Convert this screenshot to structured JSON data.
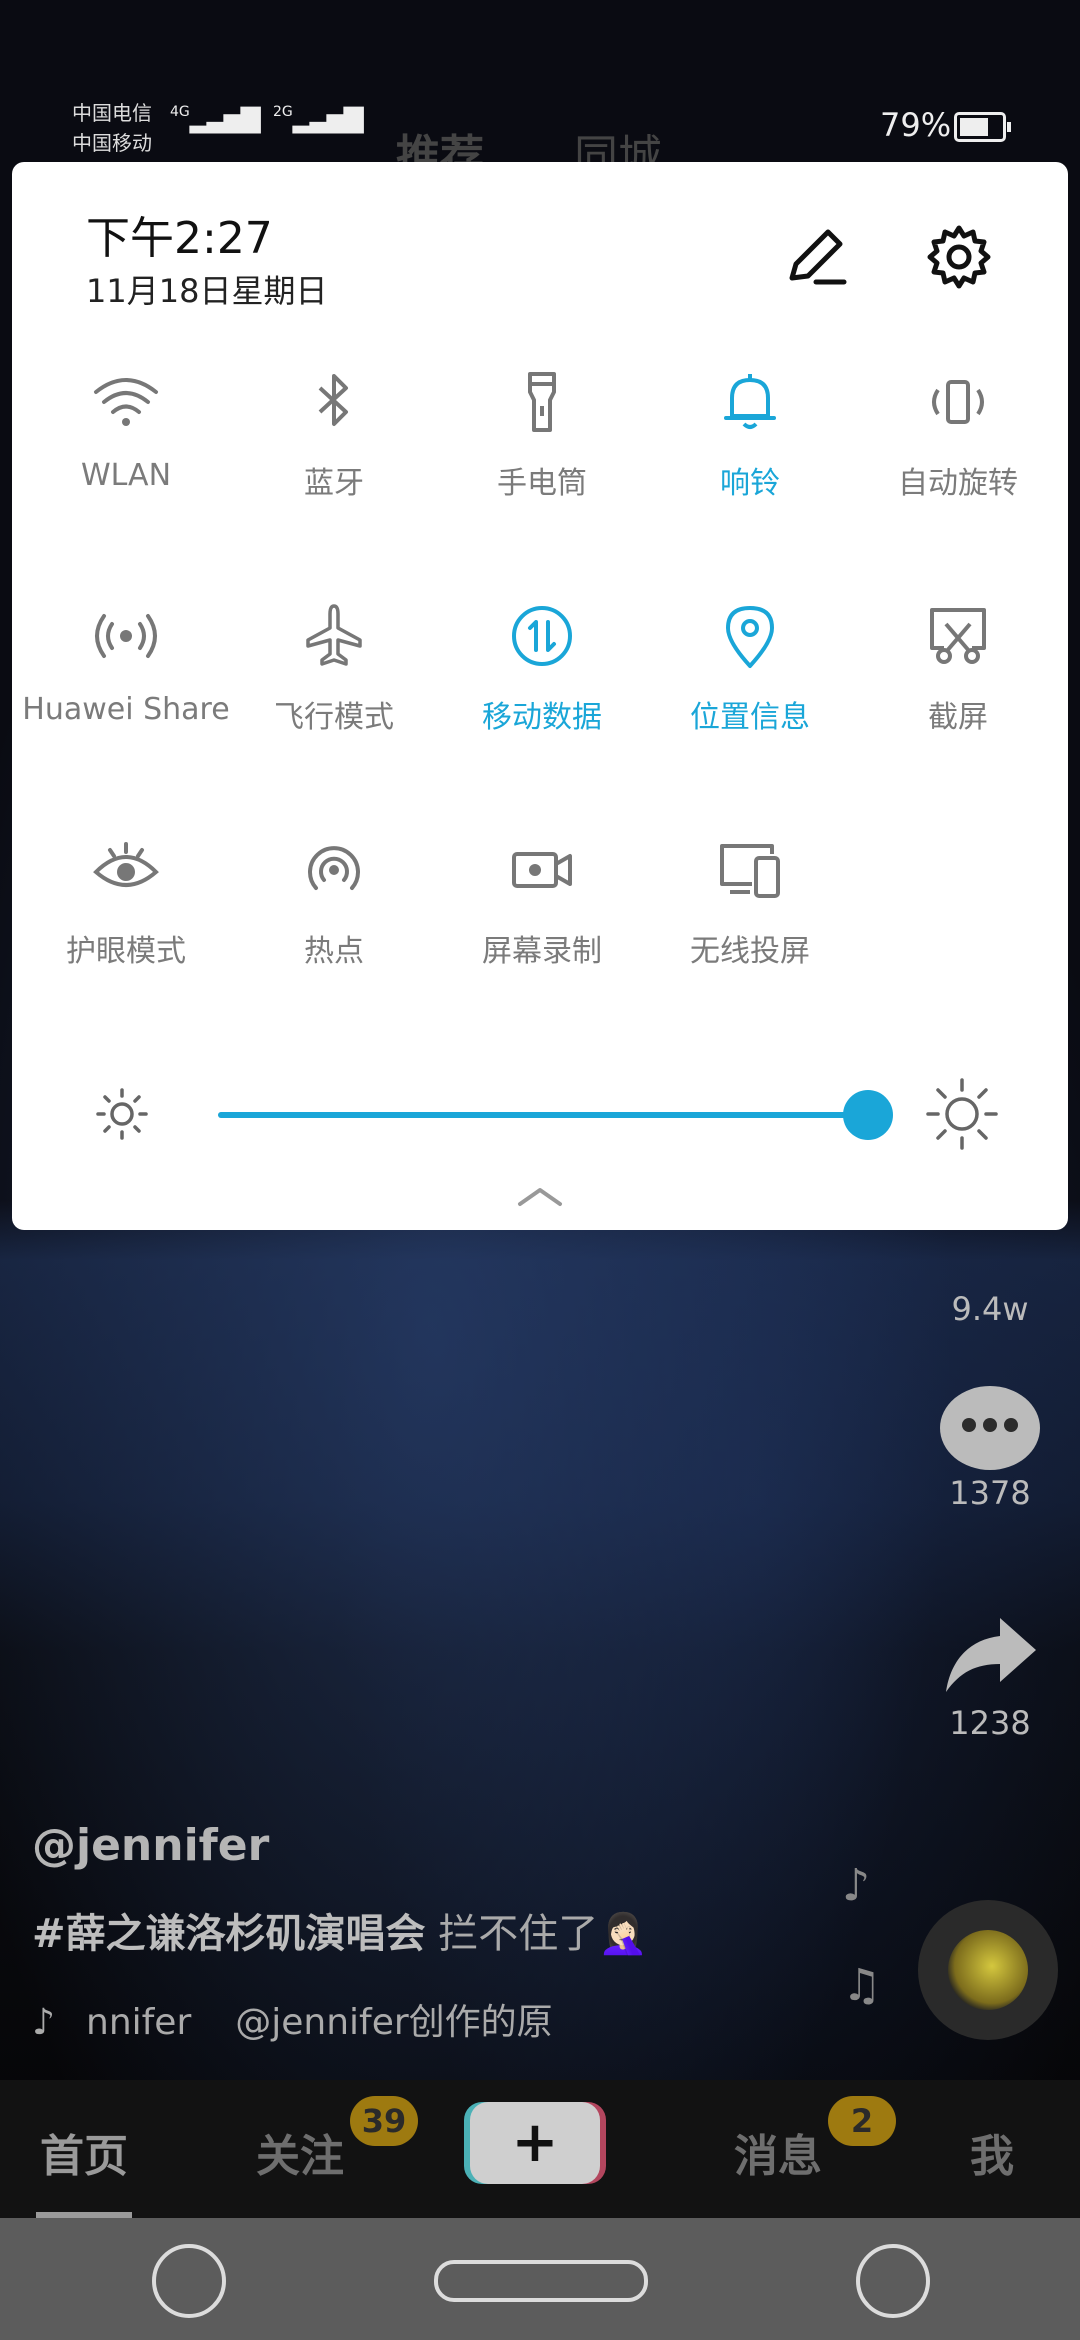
{
  "status_bar": {
    "carrier_1": "中国电信",
    "carrier_2": "中国移动",
    "net_1": "4G",
    "net_2": "2G",
    "battery_percent": "79%"
  },
  "top_tabs": [
    "推荐",
    "同城"
  ],
  "notification_panel": {
    "time": "下午2:27",
    "date": "11月18日星期日",
    "accent_color": "#1aa6d8",
    "tiles": [
      {
        "label": "WLAN",
        "icon": "wifi-icon",
        "active": false
      },
      {
        "label": "蓝牙",
        "icon": "bluetooth-icon",
        "active": false
      },
      {
        "label": "手电筒",
        "icon": "flashlight-icon",
        "active": false
      },
      {
        "label": "响铃",
        "icon": "bell-icon",
        "active": true
      },
      {
        "label": "自动旋转",
        "icon": "auto-rotate-icon",
        "active": false
      },
      {
        "label": "Huawei Share",
        "icon": "huawei-share-icon",
        "active": false
      },
      {
        "label": "飞行模式",
        "icon": "airplane-icon",
        "active": false
      },
      {
        "label": "移动数据",
        "icon": "mobile-data-icon",
        "active": true
      },
      {
        "label": "位置信息",
        "icon": "location-icon",
        "active": true
      },
      {
        "label": "截屏",
        "icon": "screenshot-icon",
        "active": false
      },
      {
        "label": "护眼模式",
        "icon": "eye-comfort-icon",
        "active": false
      },
      {
        "label": "热点",
        "icon": "hotspot-icon",
        "active": false
      },
      {
        "label": "屏幕录制",
        "icon": "screen-record-icon",
        "active": false
      },
      {
        "label": "无线投屏",
        "icon": "wireless-projection-icon",
        "active": false
      }
    ],
    "brightness_level": 1.0
  },
  "video": {
    "like_count": "9.4w",
    "comment_count": "1378",
    "share_count": "1238",
    "author": "@jennifer",
    "hashtag": "#薛之谦洛杉矶演唱会",
    "caption_text": " 拦不住了🤦🏻‍♀️",
    "music_author": "nnifer",
    "music_title": "@jennifer创作的原"
  },
  "bottom_nav": {
    "home": "首页",
    "follow": "关注",
    "follow_badge": "39",
    "plus": "+",
    "messages": "消息",
    "messages_badge": "2",
    "me": "我"
  }
}
